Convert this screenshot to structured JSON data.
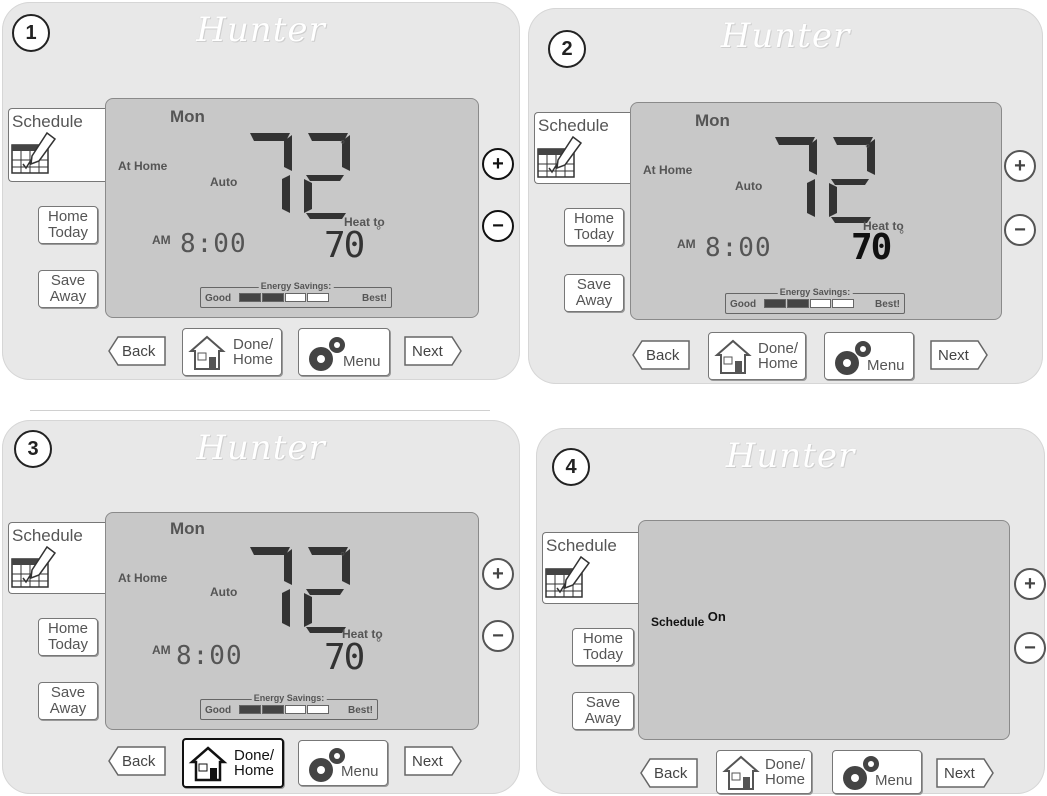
{
  "brand": "Hunter",
  "labels": {
    "schedule": "Schedule",
    "home": "Home",
    "today": "Today",
    "save": "Save",
    "away": "Away",
    "back": "Back",
    "done": "Done/",
    "done_home": "Home",
    "menu": "Menu",
    "next": "Next",
    "plus": "+",
    "minus": "−",
    "degree": "°"
  },
  "display": {
    "day": "Mon",
    "mode": "At Home",
    "fan": "Auto",
    "current_temp": "72",
    "setpoint_label": "Heat to",
    "setpoint": "70",
    "ampm": "AM",
    "time": "8:00",
    "energy_label": "Energy Savings:",
    "energy_good": "Good",
    "energy_best": "Best!",
    "energy_level": 2,
    "energy_segments": 4
  },
  "steps": [
    {
      "number": "1"
    },
    {
      "number": "2"
    },
    {
      "number": "3"
    },
    {
      "number": "4"
    }
  ],
  "step4": {
    "schedule_word": "Schedule",
    "on_word": "On"
  }
}
